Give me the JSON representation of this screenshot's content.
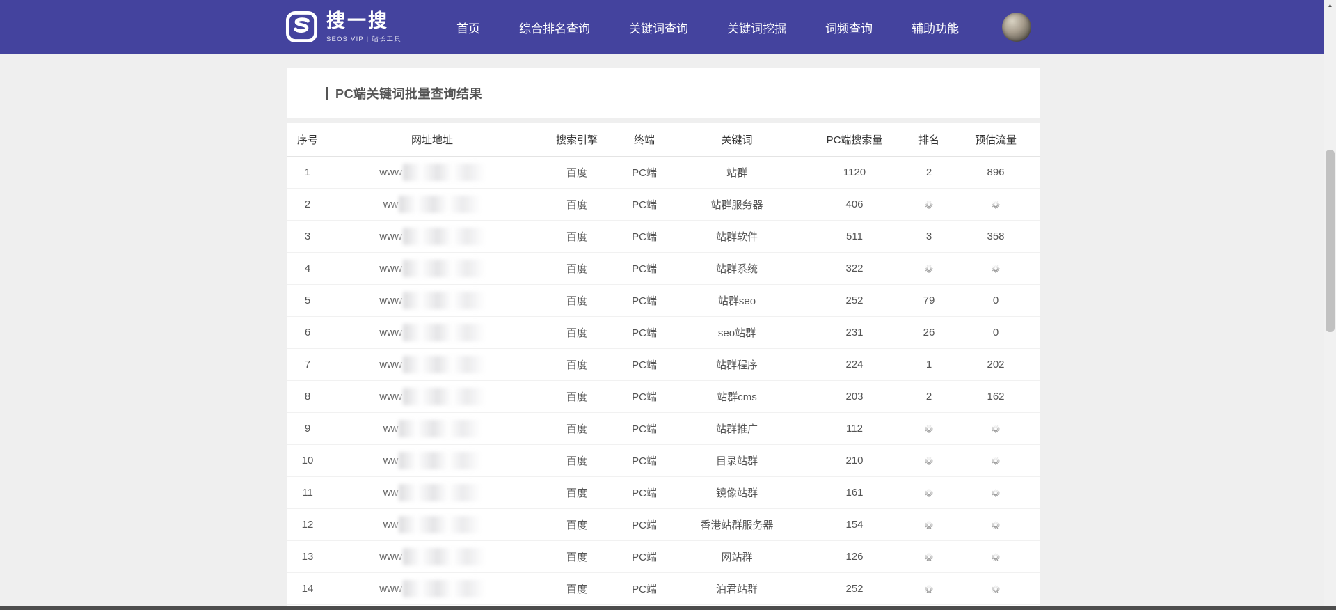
{
  "colors": {
    "accent": "#44439e",
    "spinner": "#8a8a8a",
    "scroll_thumb": "#c1c1c1"
  },
  "header": {
    "logo": {
      "title": "搜一搜",
      "tagline": "SEOS VIP | 站长工具"
    },
    "nav": [
      {
        "label": "首页"
      },
      {
        "label": "综合排名查询"
      },
      {
        "label": "关键词查询"
      },
      {
        "label": "关键词挖掘"
      },
      {
        "label": "词频查询"
      },
      {
        "label": "辅助功能"
      }
    ]
  },
  "page": {
    "title": "PC端关键词批量查询结果"
  },
  "table": {
    "columns": [
      "序号",
      "网址地址",
      "搜索引擎",
      "终端",
      "关键词",
      "PC端搜索量",
      "排名",
      "预估流量"
    ],
    "url_redacted": true,
    "loading_token": "loading",
    "rows": [
      {
        "index": "1",
        "url_prefix": "www",
        "engine": "百度",
        "device": "PC端",
        "keyword": "站群",
        "volume": "1120",
        "rank": "2",
        "traffic": "896"
      },
      {
        "index": "2",
        "url_prefix": "ww",
        "engine": "百度",
        "device": "PC端",
        "keyword": "站群服务器",
        "volume": "406",
        "rank": "loading",
        "traffic": "loading"
      },
      {
        "index": "3",
        "url_prefix": "www",
        "engine": "百度",
        "device": "PC端",
        "keyword": "站群软件",
        "volume": "511",
        "rank": "3",
        "traffic": "358"
      },
      {
        "index": "4",
        "url_prefix": "www",
        "engine": "百度",
        "device": "PC端",
        "keyword": "站群系统",
        "volume": "322",
        "rank": "loading",
        "traffic": "loading"
      },
      {
        "index": "5",
        "url_prefix": "www",
        "engine": "百度",
        "device": "PC端",
        "keyword": "站群seo",
        "volume": "252",
        "rank": "79",
        "traffic": "0"
      },
      {
        "index": "6",
        "url_prefix": "www",
        "engine": "百度",
        "device": "PC端",
        "keyword": "seo站群",
        "volume": "231",
        "rank": "26",
        "traffic": "0"
      },
      {
        "index": "7",
        "url_prefix": "www",
        "engine": "百度",
        "device": "PC端",
        "keyword": "站群程序",
        "volume": "224",
        "rank": "1",
        "traffic": "202"
      },
      {
        "index": "8",
        "url_prefix": "www",
        "engine": "百度",
        "device": "PC端",
        "keyword": "站群cms",
        "volume": "203",
        "rank": "2",
        "traffic": "162"
      },
      {
        "index": "9",
        "url_prefix": "ww",
        "engine": "百度",
        "device": "PC端",
        "keyword": "站群推广",
        "volume": "112",
        "rank": "loading",
        "traffic": "loading"
      },
      {
        "index": "10",
        "url_prefix": "ww",
        "engine": "百度",
        "device": "PC端",
        "keyword": "目录站群",
        "volume": "210",
        "rank": "loading",
        "traffic": "loading"
      },
      {
        "index": "11",
        "url_prefix": "ww",
        "engine": "百度",
        "device": "PC端",
        "keyword": "镜像站群",
        "volume": "161",
        "rank": "loading",
        "traffic": "loading"
      },
      {
        "index": "12",
        "url_prefix": "ww",
        "engine": "百度",
        "device": "PC端",
        "keyword": "香港站群服务器",
        "volume": "154",
        "rank": "loading",
        "traffic": "loading"
      },
      {
        "index": "13",
        "url_prefix": "www",
        "engine": "百度",
        "device": "PC端",
        "keyword": "网站群",
        "volume": "126",
        "rank": "loading",
        "traffic": "loading"
      },
      {
        "index": "14",
        "url_prefix": "www",
        "engine": "百度",
        "device": "PC端",
        "keyword": "泊君站群",
        "volume": "252",
        "rank": "loading",
        "traffic": "loading"
      }
    ]
  }
}
